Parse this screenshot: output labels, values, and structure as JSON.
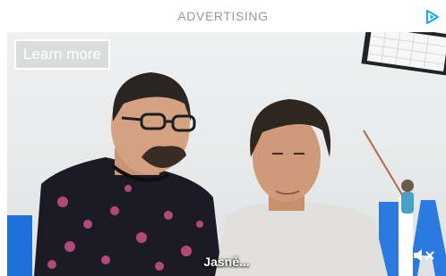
{
  "header": {
    "label": "ADVERTISING",
    "adchoices_icon": "adchoices-play-icon",
    "accent_color": "#1aa7e8"
  },
  "video": {
    "learn_more_label": "Learn more",
    "subtitle": "Jasně...",
    "mute_icon": "speaker-muted-icon"
  }
}
